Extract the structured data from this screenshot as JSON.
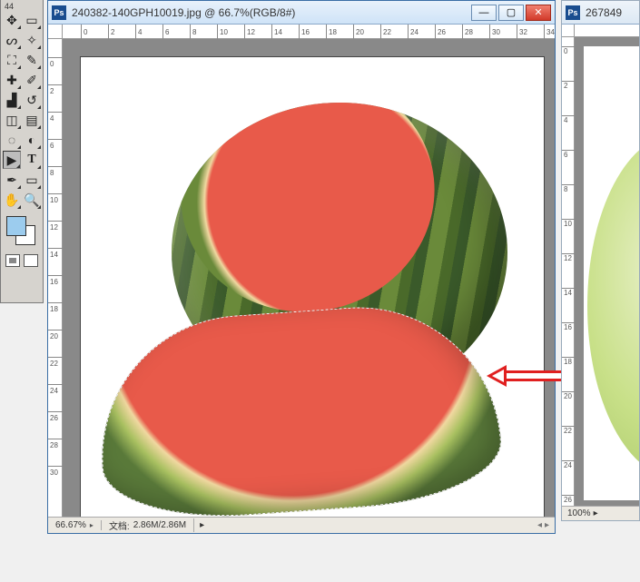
{
  "toolbox_header": "44",
  "main_doc": {
    "filename": "240382-140GPH10019.jpg",
    "zoom_title": "66.7%",
    "mode": "RGB/8#",
    "title_at": "@",
    "ruler_h": [
      0,
      2,
      4,
      6,
      8,
      10,
      12,
      14,
      16,
      18,
      20,
      22,
      24,
      26,
      28,
      30,
      32,
      34
    ],
    "ruler_v": [
      0,
      2,
      4,
      6,
      8,
      10,
      12,
      14,
      16,
      18,
      20,
      22,
      24,
      26,
      28,
      30
    ],
    "status_zoom": "66.67%",
    "status_doc_label": "文档:",
    "status_doc_value": "2.86M/2.86M"
  },
  "second_doc": {
    "filename_partial": "267849",
    "ruler_v": [
      0,
      2,
      4,
      6,
      8,
      10,
      12,
      14,
      16,
      18,
      20,
      22,
      24,
      26
    ],
    "status_zoom": "100%"
  },
  "win_controls": {
    "minimize": "―",
    "maximize": "▢",
    "close": "✕"
  },
  "icons": {
    "ps": "Ps",
    "doc": "Ps"
  }
}
